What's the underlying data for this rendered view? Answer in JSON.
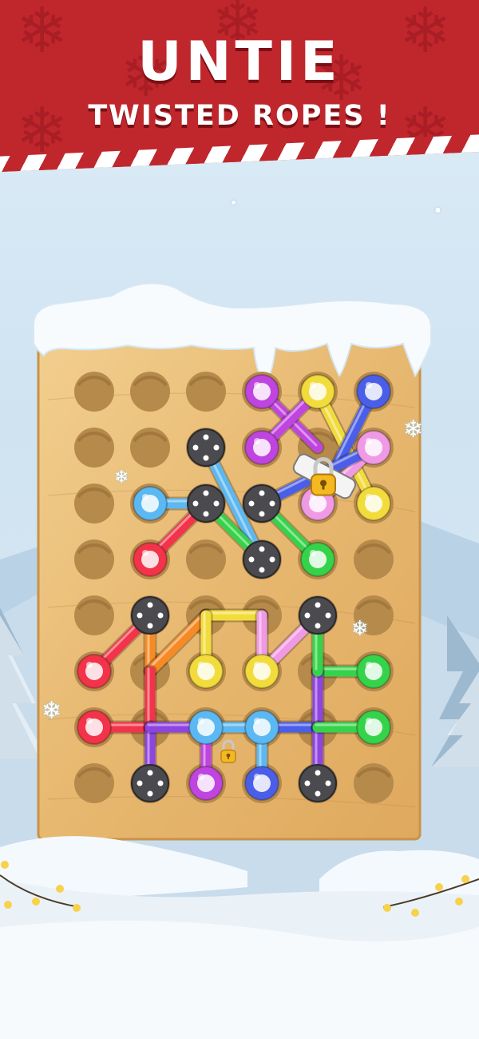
{
  "banner": {
    "title": "UNTIE",
    "subtitle": "TWISTED ROPES !"
  },
  "theme": {
    "banner_red": "#c0272d",
    "wood": "#e8bd7a",
    "hole": "#b68a4b"
  },
  "board": {
    "rows": 8,
    "cols": 6,
    "ropes": [
      {
        "color": "#c044e0",
        "from": [
          0,
          3
        ],
        "to": [
          1,
          4
        ]
      },
      {
        "color": "#f2dc3c",
        "from": [
          0,
          4
        ],
        "to": [
          2,
          5
        ]
      },
      {
        "color": "#4a5ee8",
        "from": [
          0,
          5
        ],
        "to": [
          2,
          4
        ]
      },
      {
        "color": "#c044e0",
        "from": [
          1,
          3
        ],
        "to": [
          0,
          4
        ]
      },
      {
        "color": "#f09ae6",
        "from": [
          1,
          5
        ],
        "to": [
          2,
          4
        ]
      },
      {
        "color": "#5bb8f2",
        "from": [
          1,
          2
        ],
        "to": [
          3,
          3
        ]
      },
      {
        "color": "#5bb8f2",
        "from": [
          2,
          1
        ],
        "to": [
          2,
          2
        ]
      },
      {
        "color": "#f2334a",
        "from": [
          3,
          1
        ],
        "to": [
          2,
          2
        ]
      },
      {
        "color": "#4a5ee8",
        "from": [
          2,
          3
        ],
        "to": [
          1,
          5
        ]
      },
      {
        "color": "#35d34a",
        "from": [
          2,
          2
        ],
        "to": [
          3,
          3
        ]
      },
      {
        "color": "#35d34a",
        "from": [
          3,
          4
        ],
        "to": [
          2,
          3
        ]
      },
      {
        "color": "#f2334a",
        "from": [
          5,
          0
        ],
        "to": [
          4,
          1
        ]
      },
      {
        "color": "#f78a24",
        "from": [
          4,
          1
        ],
        "to": [
          5,
          1
        ]
      },
      {
        "color": "#f78a24",
        "from": [
          5,
          1
        ],
        "to": [
          4,
          2
        ]
      },
      {
        "color": "#f2dc3c",
        "from": [
          4,
          2
        ],
        "to": [
          4,
          3
        ]
      },
      {
        "color": "#f2dc3c",
        "from": [
          5,
          2
        ],
        "to": [
          4,
          2
        ]
      },
      {
        "color": "#f09ae6",
        "from": [
          4,
          3
        ],
        "to": [
          5,
          3
        ]
      },
      {
        "color": "#f09ae6",
        "from": [
          5,
          3
        ],
        "to": [
          4,
          4
        ]
      },
      {
        "color": "#35d34a",
        "from": [
          5,
          4
        ],
        "to": [
          5,
          5
        ]
      },
      {
        "color": "#f2334a",
        "from": [
          6,
          0
        ],
        "to": [
          6,
          1
        ]
      },
      {
        "color": "#f2334a",
        "from": [
          6,
          1
        ],
        "to": [
          5,
          1
        ]
      },
      {
        "color": "#8e44e0",
        "from": [
          6,
          1
        ],
        "to": [
          7,
          1
        ]
      },
      {
        "color": "#8e44e0",
        "from": [
          6,
          1
        ],
        "to": [
          6,
          2
        ]
      },
      {
        "color": "#c044e0",
        "from": [
          6,
          2
        ],
        "to": [
          7,
          2
        ]
      },
      {
        "color": "#5bb8f2",
        "from": [
          6,
          2
        ],
        "to": [
          6,
          3
        ]
      },
      {
        "color": "#5bb8f2",
        "from": [
          6,
          3
        ],
        "to": [
          7,
          3
        ]
      },
      {
        "color": "#4a5ee8",
        "from": [
          6,
          3
        ],
        "to": [
          6,
          4
        ]
      },
      {
        "color": "#8e44e0",
        "from": [
          6,
          4
        ],
        "to": [
          5,
          4
        ]
      },
      {
        "color": "#8e44e0",
        "from": [
          6,
          4
        ],
        "to": [
          7,
          4
        ]
      },
      {
        "color": "#35d34a",
        "from": [
          6,
          4
        ],
        "to": [
          6,
          5
        ]
      },
      {
        "color": "#35d34a",
        "from": [
          5,
          4
        ],
        "to": [
          4,
          4
        ]
      }
    ],
    "colored_pegs": [
      {
        "r": 0,
        "c": 3,
        "color": "#c044e0"
      },
      {
        "r": 0,
        "c": 4,
        "color": "#f2dc3c"
      },
      {
        "r": 0,
        "c": 5,
        "color": "#4a5ee8"
      },
      {
        "r": 1,
        "c": 3,
        "color": "#c044e0"
      },
      {
        "r": 1,
        "c": 5,
        "color": "#f09ae6"
      },
      {
        "r": 2,
        "c": 1,
        "color": "#5bb8f2"
      },
      {
        "r": 2,
        "c": 4,
        "color": "#f09ae6"
      },
      {
        "r": 2,
        "c": 5,
        "color": "#f2dc3c"
      },
      {
        "r": 3,
        "c": 1,
        "color": "#f2334a"
      },
      {
        "r": 3,
        "c": 4,
        "color": "#35d34a"
      },
      {
        "r": 5,
        "c": 0,
        "color": "#f2334a"
      },
      {
        "r": 5,
        "c": 2,
        "color": "#f2dc3c"
      },
      {
        "r": 5,
        "c": 3,
        "color": "#f2dc3c"
      },
      {
        "r": 5,
        "c": 5,
        "color": "#35d34a"
      },
      {
        "r": 6,
        "c": 0,
        "color": "#f2334a"
      },
      {
        "r": 6,
        "c": 2,
        "color": "#5bb8f2"
      },
      {
        "r": 6,
        "c": 3,
        "color": "#5bb8f2"
      },
      {
        "r": 6,
        "c": 5,
        "color": "#35d34a"
      },
      {
        "r": 7,
        "c": 2,
        "color": "#c044e0"
      },
      {
        "r": 7,
        "c": 3,
        "color": "#4a5ee8"
      }
    ],
    "screw_pegs": [
      {
        "r": 1,
        "c": 2
      },
      {
        "r": 2,
        "c": 2
      },
      {
        "r": 2,
        "c": 3
      },
      {
        "r": 3,
        "c": 3
      },
      {
        "r": 4,
        "c": 1
      },
      {
        "r": 4,
        "c": 4
      },
      {
        "r": 7,
        "c": 1
      },
      {
        "r": 7,
        "c": 4
      }
    ],
    "locks": [
      {
        "name": "padlock-large",
        "r": 1.55,
        "c": 4.1,
        "color": "#f4b820"
      },
      {
        "name": "padlock-small",
        "r": 6.45,
        "c": 2.4,
        "color": "#f4b820"
      }
    ]
  }
}
